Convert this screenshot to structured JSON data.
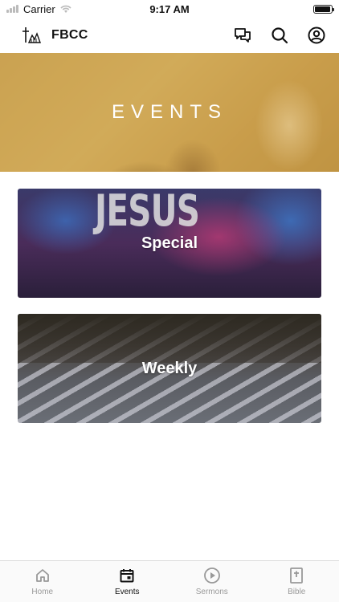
{
  "status_bar": {
    "carrier": "Carrier",
    "time": "9:17 AM",
    "battery_level": 0.95
  },
  "header": {
    "brand": "FBCC",
    "icons": [
      "logo-icon",
      "chat-icon",
      "search-icon",
      "account-icon"
    ]
  },
  "hero": {
    "title": "EVENTS"
  },
  "cards": [
    {
      "label": "Special",
      "image_text": "JESUS"
    },
    {
      "label": "Weekly"
    }
  ],
  "tabs": [
    {
      "label": "Home",
      "icon": "home-icon",
      "active": false
    },
    {
      "label": "Events",
      "icon": "calendar-icon",
      "active": true
    },
    {
      "label": "Sermons",
      "icon": "play-icon",
      "active": false
    },
    {
      "label": "Bible",
      "icon": "bible-icon",
      "active": false
    }
  ],
  "colors": {
    "active_tab": "#111111",
    "inactive_tab": "#999999",
    "hero_tint": "#cda046"
  }
}
